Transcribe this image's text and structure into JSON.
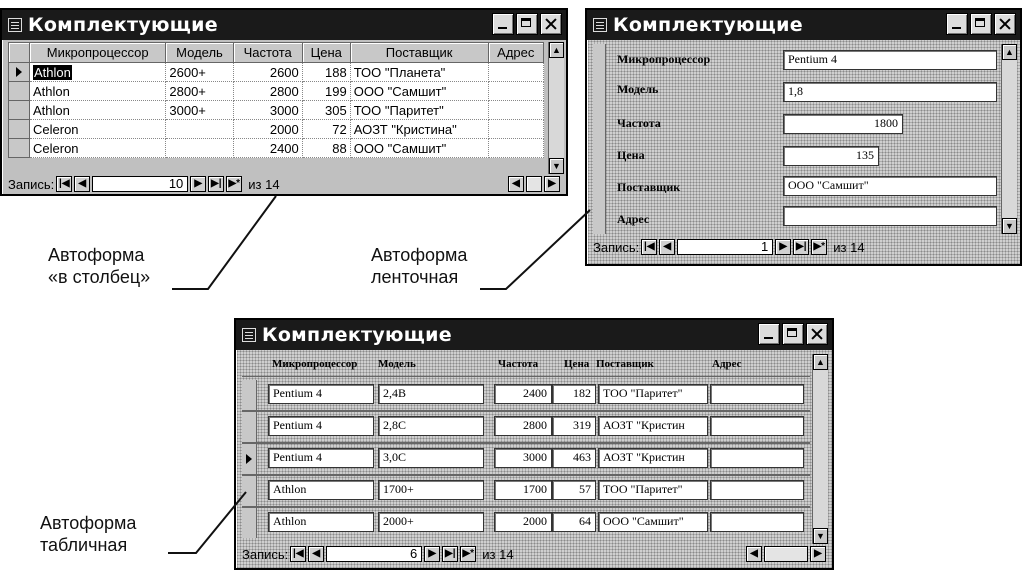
{
  "window_title": "Комплектующие",
  "win1": {
    "headers": [
      "Микропроцессор",
      "Модель",
      "Частота",
      "Цена",
      "Поставщик",
      "Адрес"
    ],
    "rows": [
      {
        "cpu": "Athlon",
        "model": "2600+",
        "freq": "2600",
        "price": "188",
        "supplier": "ТОО \"Планета\"",
        "addr": ""
      },
      {
        "cpu": "Athlon",
        "model": "2800+",
        "freq": "2800",
        "price": "199",
        "supplier": "ООО \"Самшит\"",
        "addr": ""
      },
      {
        "cpu": "Athlon",
        "model": "3000+",
        "freq": "3000",
        "price": "305",
        "supplier": "ТОО \"Паритет\"",
        "addr": ""
      },
      {
        "cpu": "Celeron",
        "model": "",
        "freq": "2000",
        "price": "72",
        "supplier": "АОЗТ \"Кристина\"",
        "addr": ""
      },
      {
        "cpu": "Celeron",
        "model": "",
        "freq": "2400",
        "price": "88",
        "supplier": "ООО \"Самшит\"",
        "addr": ""
      }
    ],
    "nav": {
      "label": "Запись:",
      "current": "10",
      "total": "из 14"
    }
  },
  "win2": {
    "fields": [
      {
        "label": "Микропроцессор",
        "value": "Pentium 4"
      },
      {
        "label": "Модель",
        "value": "1,8"
      },
      {
        "label": "Частота",
        "value": "1800"
      },
      {
        "label": "Цена",
        "value": "135"
      },
      {
        "label": "Поставщик",
        "value": "ООО \"Самшит\""
      },
      {
        "label": "Адрес",
        "value": ""
      }
    ],
    "nav": {
      "label": "Запись:",
      "current": "1",
      "total": "из 14"
    }
  },
  "win3": {
    "headers": [
      "Микропроцессор",
      "Модель",
      "Частота",
      "Цена",
      "Поставщик",
      "Адрес"
    ],
    "rows": [
      {
        "cpu": "Pentium 4",
        "model": "2,4B",
        "freq": "2400",
        "price": "182",
        "supplier": "ТОО \"Паритет\"",
        "addr": ""
      },
      {
        "cpu": "Pentium 4",
        "model": "2,8C",
        "freq": "2800",
        "price": "319",
        "supplier": "АОЗТ \"Кристин",
        "addr": ""
      },
      {
        "cpu": "Pentium 4",
        "model": "3,0C",
        "freq": "3000",
        "price": "463",
        "supplier": "АОЗТ \"Кристин",
        "addr": ""
      },
      {
        "cpu": "Athlon",
        "model": "1700+",
        "freq": "1700",
        "price": "57",
        "supplier": "ТОО \"Паритет\"",
        "addr": ""
      },
      {
        "cpu": "Athlon",
        "model": "2000+",
        "freq": "2000",
        "price": "64",
        "supplier": "ООО \"Самшит\"",
        "addr": ""
      }
    ],
    "nav": {
      "label": "Запись:",
      "current": "6",
      "total": "из 14"
    }
  },
  "captions": {
    "c1_line1": "Автоформа",
    "c1_line2": "«в столбец»",
    "c2_line1": "Автоформа",
    "c2_line2": "ленточная",
    "c3_line1": "Автоформа",
    "c3_line2": "табличная"
  },
  "nav_glyphs": {
    "first": "|◀",
    "prev": "◀",
    "next": "▶",
    "last": "▶|",
    "new": "▶*"
  }
}
